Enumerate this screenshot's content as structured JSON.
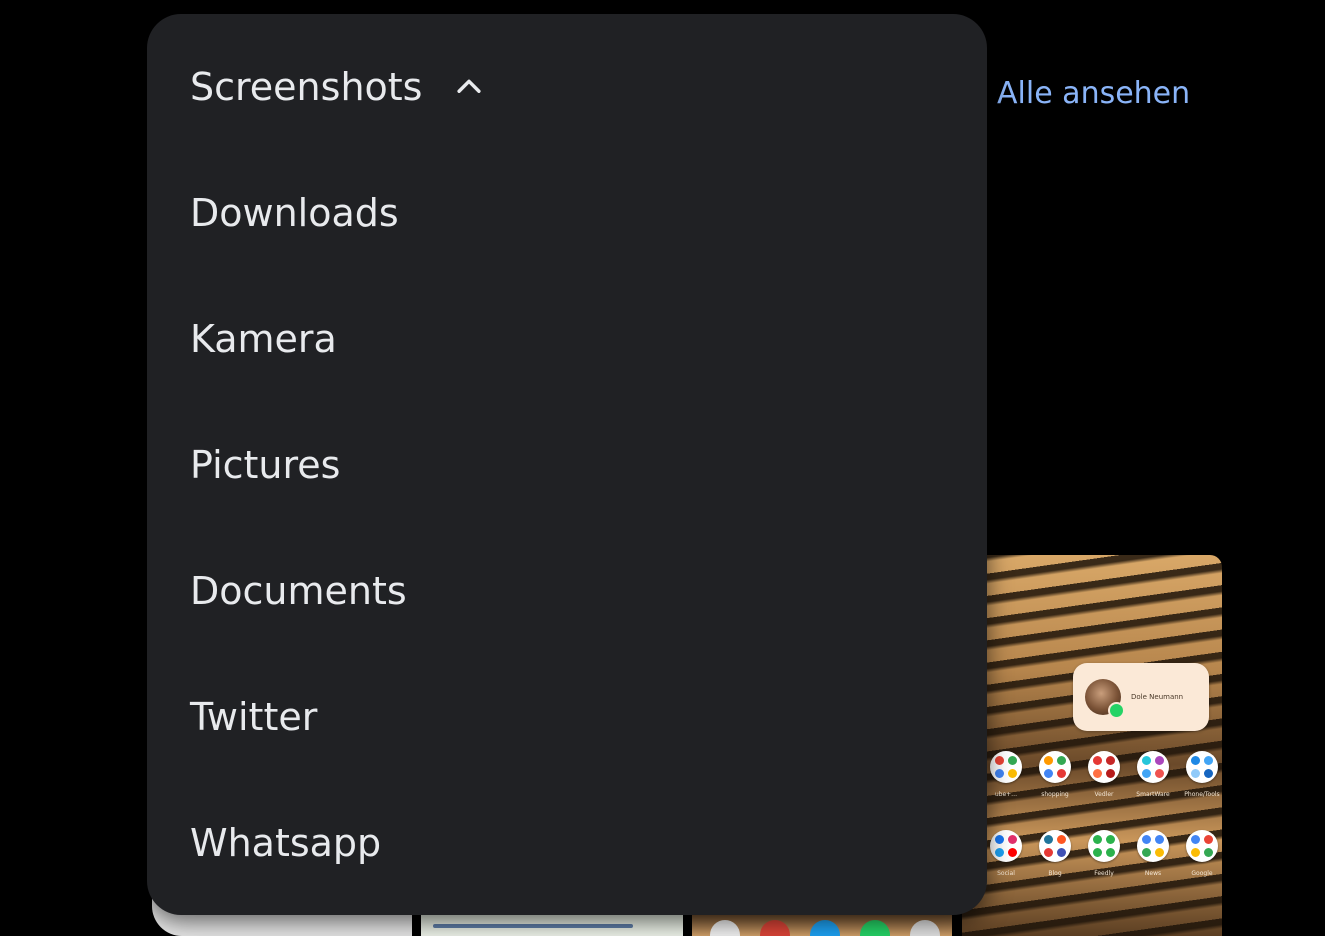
{
  "see_all": {
    "label": "Alle ansehen"
  },
  "folder_menu": {
    "selected": "Screenshots",
    "items": [
      {
        "label": "Downloads"
      },
      {
        "label": "Kamera"
      },
      {
        "label": "Pictures"
      },
      {
        "label": "Documents"
      },
      {
        "label": "Twitter"
      },
      {
        "label": "Whatsapp"
      }
    ]
  },
  "thumbnail_home": {
    "contact_name": "Dole Neumann",
    "row1": [
      {
        "label": "ube+…",
        "colors": [
          "#ea4335",
          "#34a853",
          "#4285f4",
          "#fbbc05"
        ]
      },
      {
        "label": "shopping",
        "colors": [
          "#ff9900",
          "#34a853",
          "#4285f4",
          "#e53935"
        ]
      },
      {
        "label": "Vedler",
        "colors": [
          "#e53935",
          "#c62828",
          "#ff7043",
          "#b71c1c"
        ]
      },
      {
        "label": "SmartWare",
        "colors": [
          "#26c6da",
          "#ab47bc",
          "#42a5f5",
          "#ef5350"
        ]
      },
      {
        "label": "Phone/Tools",
        "colors": [
          "#1e88e5",
          "#42a5f5",
          "#90caf9",
          "#1565c0"
        ]
      }
    ],
    "row2": [
      {
        "label": "Social",
        "colors": [
          "#1877f2",
          "#e1306c",
          "#1da1f2",
          "#ff0000"
        ]
      },
      {
        "label": "Blog",
        "colors": [
          "#21759b",
          "#ff5722",
          "#e53935",
          "#3f51b5"
        ]
      },
      {
        "label": "Feedly",
        "colors": [
          "#2bb24c",
          "#2bb24c",
          "#2bb24c",
          "#2bb24c"
        ]
      },
      {
        "label": "News",
        "colors": [
          "#4285f4",
          "#4285f4",
          "#34a853",
          "#fbbc05"
        ]
      },
      {
        "label": "Google",
        "colors": [
          "#4285f4",
          "#ea4335",
          "#fbbc05",
          "#34a853"
        ]
      }
    ]
  },
  "colors": {
    "menu_background": "#202124",
    "menu_text": "#e8eaed",
    "link": "#8ab4f8",
    "page_background": "#000000"
  }
}
